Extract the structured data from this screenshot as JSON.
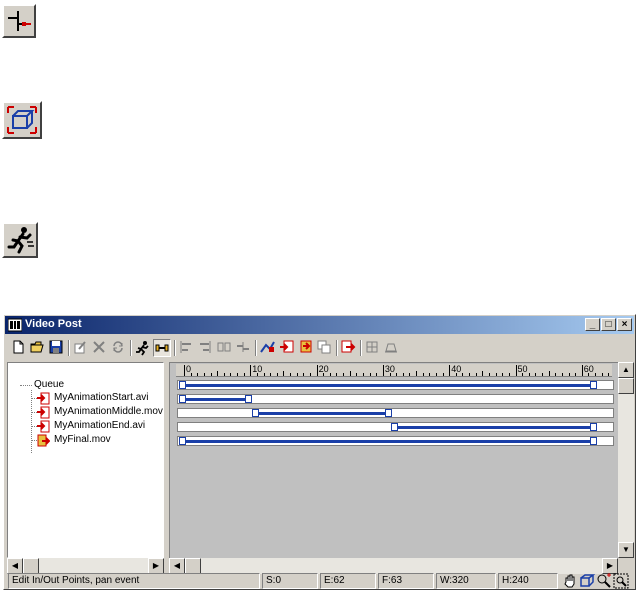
{
  "window": {
    "title": "Video Post",
    "minimize": "_",
    "maximize": "□",
    "close": "×"
  },
  "demo_icons": [
    "add-scene-event-icon",
    "bounding-box-icon",
    "execute-sequence-icon"
  ],
  "toolbar": [
    "new-sequence-icon",
    "open-sequence-icon",
    "save-sequence-icon",
    "edit-current-event-icon",
    "delete-event-icon",
    "swap-events-icon",
    "execute-sequence-icon",
    "edit-range-bar-icon",
    "align-left-icon",
    "align-right-icon",
    "make-same-size-icon",
    "abut-selected-icon",
    "add-scene-event-icon",
    "add-image-input-event-icon",
    "add-image-filter-event-icon",
    "add-image-layer-event-icon",
    "add-image-output-event-icon",
    "add-external-event-icon",
    "add-loop-event-icon"
  ],
  "queue": {
    "root": "Queue",
    "items": [
      {
        "label": "MyAnimationStart.avi",
        "icon": "image-input-event-icon"
      },
      {
        "label": "MyAnimationMiddle.mov",
        "icon": "image-input-event-icon"
      },
      {
        "label": "MyAnimationEnd.avi",
        "icon": "image-input-event-icon"
      },
      {
        "label": "MyFinal.mov",
        "icon": "image-output-event-icon"
      }
    ]
  },
  "timeline": {
    "ticks": [
      "0",
      "10",
      "20",
      "30",
      "40",
      "50",
      "60"
    ],
    "frame_min": 0,
    "frame_max": 64,
    "tracks": [
      {
        "start": 0,
        "end": 62
      },
      {
        "start": 0,
        "end": 10
      },
      {
        "start": 11,
        "end": 31
      },
      {
        "start": 32,
        "end": 62
      },
      {
        "start": 0,
        "end": 62
      }
    ]
  },
  "status": {
    "message": "Edit In/Out Points, pan event",
    "start": "S:0",
    "end": "E:62",
    "frames": "F:63",
    "width": "W:320",
    "height": "H:240",
    "nav_icons": [
      "pan-hand-icon",
      "zoom-extents-icon",
      "zoom-time-icon",
      "zoom-region-icon"
    ]
  }
}
